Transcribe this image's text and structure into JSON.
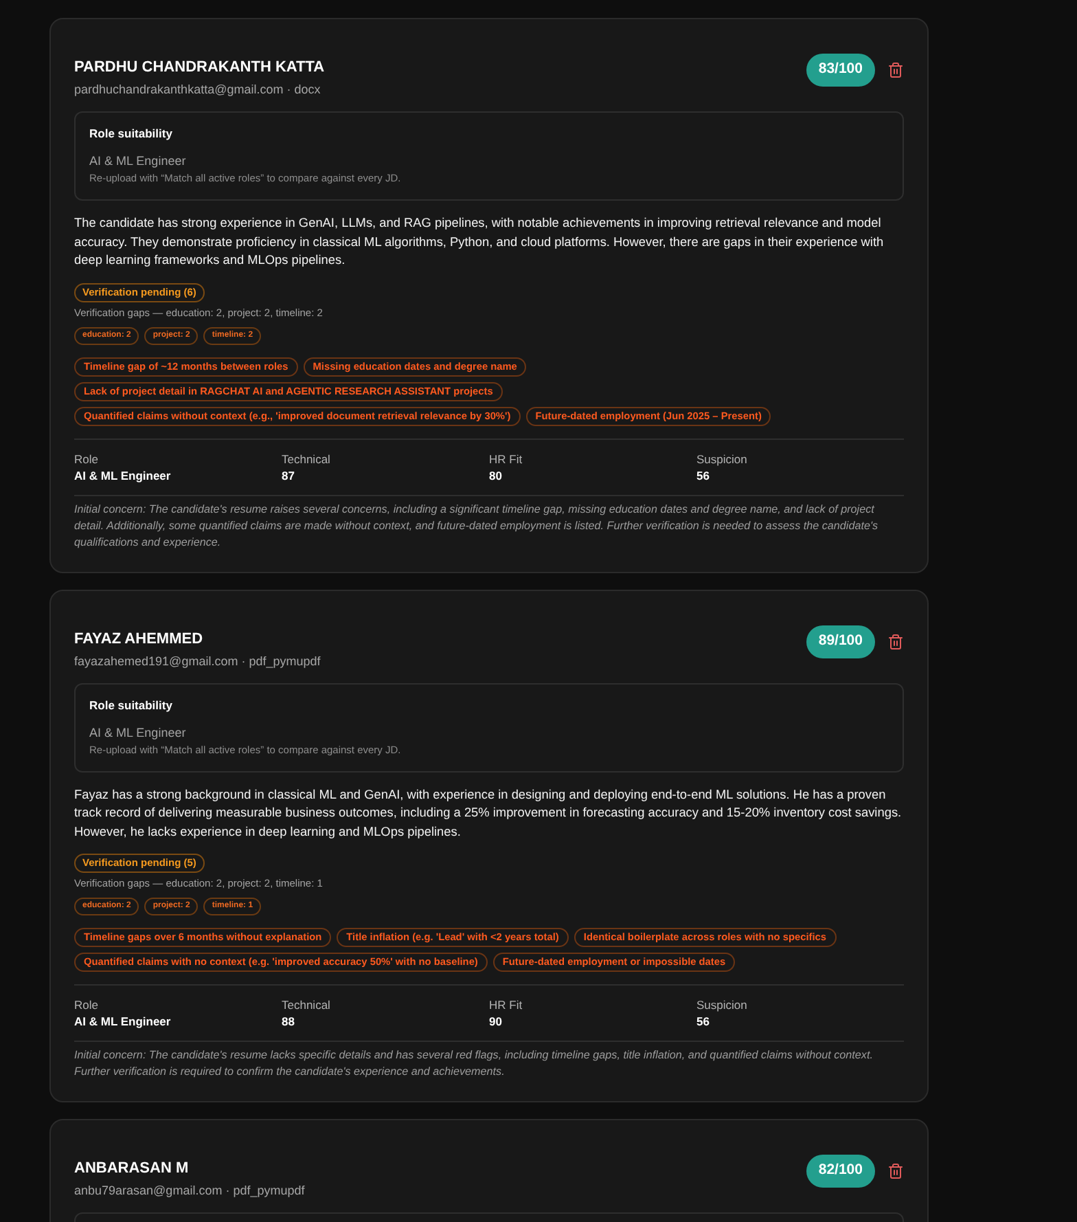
{
  "candidates": [
    {
      "name": "PARDHU CHANDRAKANTH KATTA",
      "meta": "pardhuchandrakanthkatta@gmail.com · docx",
      "score": "83/100",
      "role_suitability": {
        "title": "Role suitability",
        "role": "AI & ML Engineer",
        "note": "Re-upload with “Match all active roles” to compare against every JD."
      },
      "summary": "The candidate has strong experience in GenAI, LLMs, and RAG pipelines, with notable achievements in improving retrieval relevance and model accuracy. They demonstrate proficiency in classical ML algorithms, Python, and cloud platforms. However, there are gaps in their experience with deep learning frameworks and MLOps pipelines.",
      "verification": {
        "label": "Verification pending (6)",
        "gaps": "Verification gaps — education: 2, project: 2, timeline: 2",
        "chips": [
          "education: 2",
          "project: 2",
          "timeline: 2"
        ]
      },
      "flags": [
        "Timeline gap of ~12 months between roles",
        "Missing education dates and degree name",
        "Lack of project detail in RAGCHAT AI and AGENTIC RESEARCH ASSISTANT projects",
        "Quantified claims without context (e.g., 'improved document retrieval relevance by 30%')",
        "Future-dated employment (Jun 2025 – Present)"
      ],
      "stats": [
        {
          "label": "Role",
          "value": "AI & ML Engineer"
        },
        {
          "label": "Technical",
          "value": "87"
        },
        {
          "label": "HR Fit",
          "value": "80"
        },
        {
          "label": "Suspicion",
          "value": "56"
        }
      ],
      "concern": "Initial concern: The candidate's resume raises several concerns, including a significant timeline gap, missing education dates and degree name, and lack of project detail. Additionally, some quantified claims are made without context, and future-dated employment is listed. Further verification is needed to assess the candidate's qualifications and experience."
    },
    {
      "name": "FAYAZ AHEMMED",
      "meta": "fayazahemed191@gmail.com · pdf_pymupdf",
      "score": "89/100",
      "role_suitability": {
        "title": "Role suitability",
        "role": "AI & ML Engineer",
        "note": "Re-upload with “Match all active roles” to compare against every JD."
      },
      "summary": "Fayaz has a strong background in classical ML and GenAI, with experience in designing and deploying end-to-end ML solutions. He has a proven track record of delivering measurable business outcomes, including a 25% improvement in forecasting accuracy and 15-20% inventory cost savings. However, he lacks experience in deep learning and MLOps pipelines.",
      "verification": {
        "label": "Verification pending (5)",
        "gaps": "Verification gaps — education: 2, project: 2, timeline: 1",
        "chips": [
          "education: 2",
          "project: 2",
          "timeline: 1"
        ]
      },
      "flags": [
        "Timeline gaps over 6 months without explanation",
        "Title inflation (e.g. 'Lead' with <2 years total)",
        "Identical boilerplate across roles with no specifics",
        "Quantified claims with no context (e.g. 'improved accuracy 50%' with no baseline)",
        "Future-dated employment or impossible dates"
      ],
      "stats": [
        {
          "label": "Role",
          "value": "AI & ML Engineer"
        },
        {
          "label": "Technical",
          "value": "88"
        },
        {
          "label": "HR Fit",
          "value": "90"
        },
        {
          "label": "Suspicion",
          "value": "56"
        }
      ],
      "concern": "Initial concern: The candidate's resume lacks specific details and has several red flags, including timeline gaps, title inflation, and quantified claims without context. Further verification is required to confirm the candidate's experience and achievements."
    },
    {
      "name": "ANBARASAN M",
      "meta": "anbu79arasan@gmail.com · pdf_pymupdf",
      "score": "82/100"
    }
  ]
}
